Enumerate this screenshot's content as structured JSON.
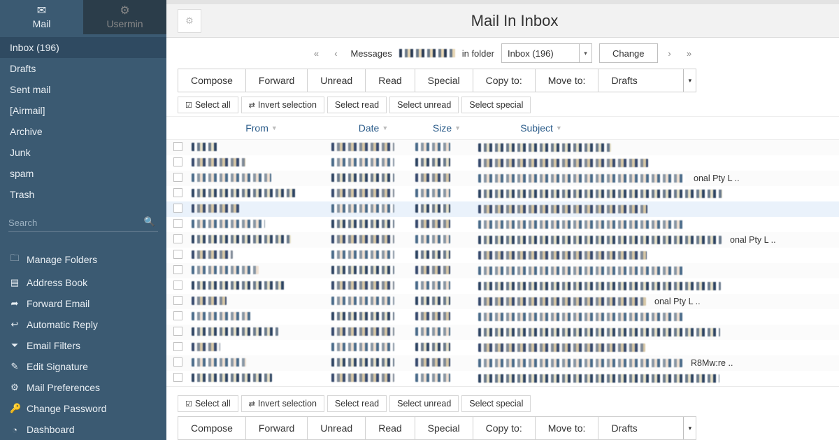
{
  "tabs": {
    "mail": "Mail",
    "usermin": "Usermin"
  },
  "folders": [
    "Inbox (196)",
    "Drafts",
    "Sent mail",
    "[Airmail]",
    "Archive",
    "Junk",
    "spam",
    "Trash"
  ],
  "search_placeholder": "Search",
  "tools": [
    {
      "icon": "folder",
      "label": "Manage Folders"
    },
    {
      "icon": "book",
      "label": "Address Book"
    },
    {
      "icon": "fwd",
      "label": "Forward Email"
    },
    {
      "icon": "reply",
      "label": "Automatic Reply"
    },
    {
      "icon": "filter",
      "label": "Email Filters"
    },
    {
      "icon": "edit",
      "label": "Edit Signature"
    },
    {
      "icon": "gear",
      "label": "Mail Preferences"
    },
    {
      "icon": "key",
      "label": "Change Password"
    },
    {
      "icon": "dash",
      "label": "Dashboard"
    }
  ],
  "title": "Mail In Inbox",
  "nav": {
    "messages_label": "Messages",
    "infolder_label": "in folder",
    "folder_value": "Inbox (196)",
    "change_label": "Change"
  },
  "commands": [
    "Compose",
    "Forward",
    "Unread",
    "Read",
    "Special",
    "Copy to:",
    "Move to:"
  ],
  "moveto_value": "Drafts",
  "pills": {
    "select_all": "Select all",
    "invert": "Invert selection",
    "select_read": "Select read",
    "select_unread": "Select unread",
    "select_special": "Select special"
  },
  "columns": {
    "from": "From",
    "date": "Date",
    "size": "Size",
    "subject": "Subject"
  },
  "rows": [
    {
      "highlight": false,
      "extra": ""
    },
    {
      "highlight": false,
      "extra": ""
    },
    {
      "highlight": false,
      "extra": "onal Pty L .."
    },
    {
      "highlight": false,
      "extra": ""
    },
    {
      "highlight": true,
      "extra": ""
    },
    {
      "highlight": false,
      "extra": ""
    },
    {
      "highlight": false,
      "extra": "onal Pty L .."
    },
    {
      "highlight": false,
      "extra": ""
    },
    {
      "highlight": false,
      "extra": ""
    },
    {
      "highlight": false,
      "extra": ""
    },
    {
      "highlight": false,
      "extra": "onal Pty L .."
    },
    {
      "highlight": false,
      "extra": ""
    },
    {
      "highlight": false,
      "extra": ""
    },
    {
      "highlight": false,
      "extra": ""
    },
    {
      "highlight": false,
      "extra": "R8Mw:re .."
    },
    {
      "highlight": false,
      "extra": ""
    },
    {
      "highlight": false,
      "extra": ""
    },
    {
      "highlight": false,
      "extra": ""
    },
    {
      "highlight": false,
      "extra": ""
    }
  ]
}
